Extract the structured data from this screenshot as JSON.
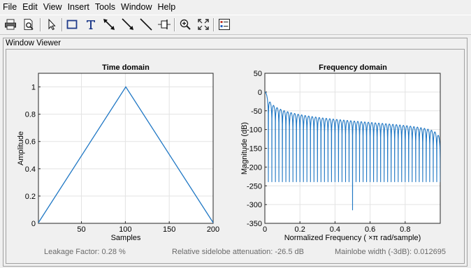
{
  "menubar": {
    "items": [
      "File",
      "Edit",
      "View",
      "Insert",
      "Tools",
      "Window",
      "Help"
    ]
  },
  "toolbar": {
    "buttons": [
      "print-icon",
      "print-preview-icon",
      "pointer-icon",
      "rectangle-icon",
      "text-icon",
      "double-arrow-icon",
      "arrow-icon",
      "line-icon",
      "data-cursor-icon",
      "zoom-in-icon",
      "fit-icon",
      "legend-icon"
    ]
  },
  "panel": {
    "title": "Window Viewer"
  },
  "status": {
    "leakage": "Leakage Factor: 0.28 %",
    "sidelobe": "Relative sidelobe attenuation: -26.5 dB",
    "mainlobe": "Mainlobe width (-3dB): 0.012695"
  },
  "chart_data": [
    {
      "type": "line",
      "title": "Time domain",
      "xlabel": "Samples",
      "ylabel": "Amplitude",
      "xlim": [
        1,
        200
      ],
      "ylim": [
        0,
        1.1
      ],
      "xticks": [
        50,
        100,
        150,
        200
      ],
      "yticks": [
        0,
        0.2,
        0.4,
        0.6,
        0.8,
        1
      ],
      "xtick_labels": [
        "50",
        "100",
        "150",
        "200"
      ],
      "ytick_labels": [
        "0",
        "0.2",
        "0.4",
        "0.6",
        "0.8",
        "1"
      ],
      "grid": true,
      "color": "#1f77c4",
      "series": [
        {
          "x": [
            1,
            100.5,
            200
          ],
          "y": [
            0.005,
            1,
            0.005
          ]
        }
      ]
    },
    {
      "type": "line",
      "title": "Frequency domain",
      "xlabel": "Normalized  Frequency    ( ×π  rad/sample)",
      "ylabel": "Magnitude (dB)",
      "xlim": [
        0,
        1
      ],
      "ylim": [
        -350,
        50
      ],
      "xticks": [
        0,
        0.2,
        0.4,
        0.6,
        0.8
      ],
      "yticks": [
        50,
        0,
        -50,
        -100,
        -150,
        -200,
        -250,
        -300,
        -350
      ],
      "xtick_labels": [
        "0",
        "0.2",
        "0.4",
        "0.6",
        "0.8"
      ],
      "ytick_labels": [
        "50",
        "0",
        "-50",
        "-100",
        "-150",
        "-200",
        "-250",
        "-300",
        "-350"
      ],
      "grid": true,
      "color": "#1f77c4",
      "series": [
        {
          "name": "",
          "window": "triangular",
          "length": 200,
          "deep_null": {
            "x": 0.5,
            "y": -315
          }
        }
      ]
    }
  ]
}
